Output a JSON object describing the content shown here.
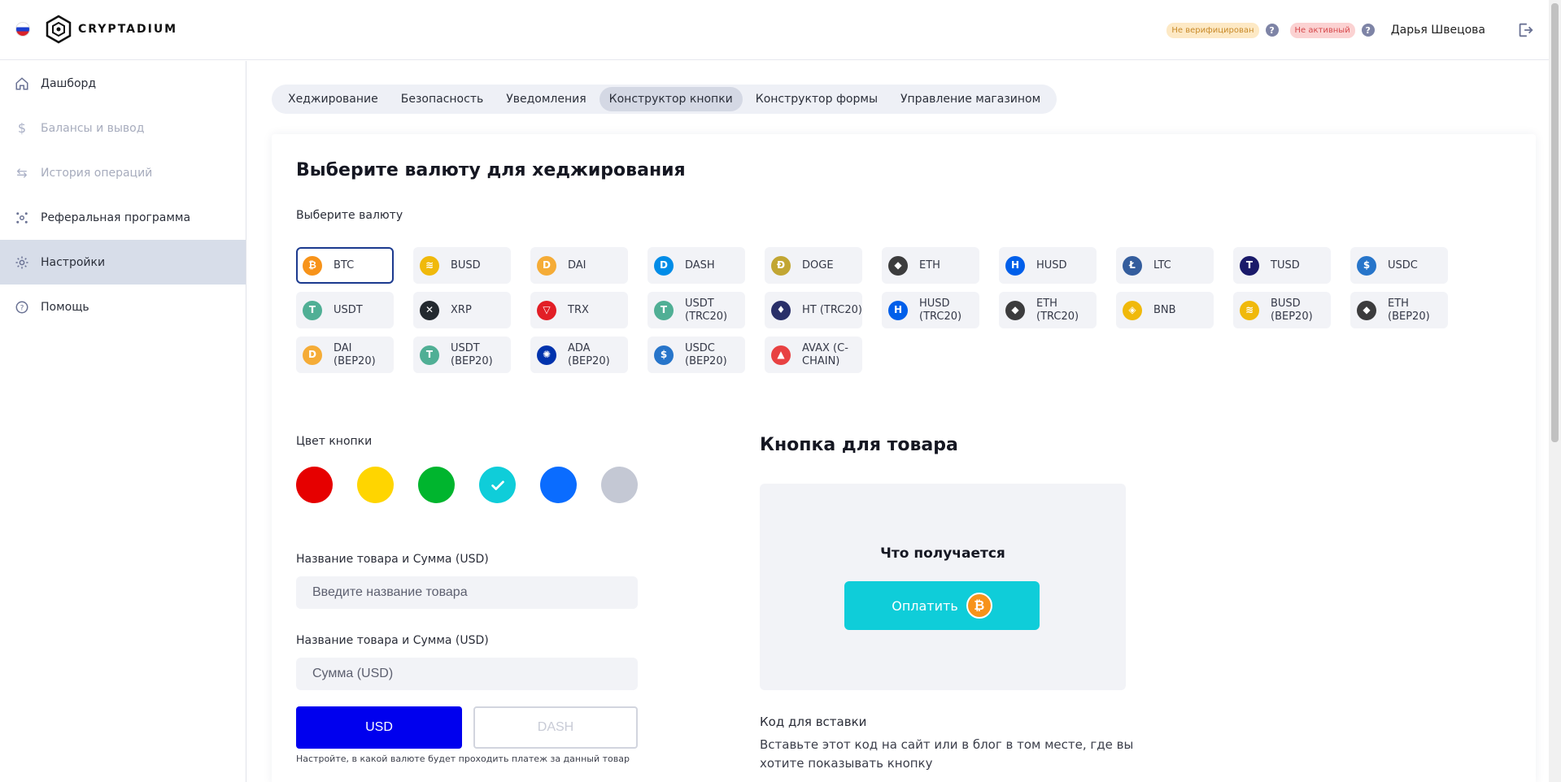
{
  "header": {
    "logo_text": "CRYPTADIUM",
    "badge_unverified": "Не верифицирован",
    "badge_inactive": "Не активный",
    "help_mark": "?",
    "user_name": "Дарья Швецова"
  },
  "sidebar": {
    "items": [
      {
        "label": "Дашборд",
        "icon": "home-icon",
        "state": "normal"
      },
      {
        "label": "Балансы и вывод",
        "icon": "dollar-icon",
        "state": "disabled"
      },
      {
        "label": "История операций",
        "icon": "arrows-icon",
        "state": "disabled"
      },
      {
        "label": "Реферальная программа",
        "icon": "network-icon",
        "state": "normal"
      },
      {
        "label": "Настройки",
        "icon": "gear-icon",
        "state": "active"
      },
      {
        "label": "Помощь",
        "icon": "help-icon",
        "state": "normal"
      }
    ]
  },
  "tabs": [
    {
      "label": "Хеджирование"
    },
    {
      "label": "Безопасность"
    },
    {
      "label": "Уведомления"
    },
    {
      "label": "Конструктор кнопки",
      "active": true
    },
    {
      "label": "Конструктор формы"
    },
    {
      "label": "Управление магазином"
    }
  ],
  "main": {
    "title": "Выберите валюту для хеджирования",
    "currency_label": "Выберите валюту",
    "currencies": [
      {
        "label": "BTC",
        "color": "#f7931a",
        "glyph": "₿",
        "selected": true
      },
      {
        "label": "BUSD",
        "color": "#f0b90b",
        "glyph": "≋"
      },
      {
        "label": "DAI",
        "color": "#f5ac37",
        "glyph": "D"
      },
      {
        "label": "DASH",
        "color": "#008ce7",
        "glyph": "D"
      },
      {
        "label": "DOGE",
        "color": "#c2a633",
        "glyph": "Ð"
      },
      {
        "label": "ETH",
        "color": "#3c3c3d",
        "glyph": "◆"
      },
      {
        "label": "HUSD",
        "color": "#005fea",
        "glyph": "H"
      },
      {
        "label": "LTC",
        "color": "#345d9d",
        "glyph": "Ł"
      },
      {
        "label": "TUSD",
        "color": "#1a1a6a",
        "glyph": "T"
      },
      {
        "label": "USDC",
        "color": "#2775ca",
        "glyph": "$"
      },
      {
        "label": "USDT",
        "color": "#50af95",
        "glyph": "T"
      },
      {
        "label": "XRP",
        "color": "#23292f",
        "glyph": "✕"
      },
      {
        "label": "TRX",
        "color": "#e21e26",
        "glyph": "▽"
      },
      {
        "label": "USDT (TRC20)",
        "color": "#50af95",
        "glyph": "T"
      },
      {
        "label": "HT (TRC20)",
        "color": "#2a3069",
        "glyph": "♦"
      },
      {
        "label": "HUSD (TRC20)",
        "color": "#005fea",
        "glyph": "H"
      },
      {
        "label": "ETH (TRC20)",
        "color": "#3c3c3d",
        "glyph": "◆"
      },
      {
        "label": "BNB",
        "color": "#f0b90b",
        "glyph": "◈"
      },
      {
        "label": "BUSD (BEP20)",
        "color": "#f0b90b",
        "glyph": "≋"
      },
      {
        "label": "ETH (BEP20)",
        "color": "#3c3c3d",
        "glyph": "◆"
      },
      {
        "label": "DAI (BEP20)",
        "color": "#f5ac37",
        "glyph": "D"
      },
      {
        "label": "USDT (BEP20)",
        "color": "#50af95",
        "glyph": "T"
      },
      {
        "label": "ADA (BEP20)",
        "color": "#0033ad",
        "glyph": "✺"
      },
      {
        "label": "USDC (BEP20)",
        "color": "#2775ca",
        "glyph": "$"
      },
      {
        "label": "AVAX (C-CHAIN)",
        "color": "#e84142",
        "glyph": "▲"
      }
    ],
    "color_label": "Цвет кнопки",
    "button_colors": [
      {
        "hex": "#e60000",
        "selected": false
      },
      {
        "hex": "#ffd500",
        "selected": false
      },
      {
        "hex": "#00b52e",
        "selected": false
      },
      {
        "hex": "#0fcdd9",
        "selected": true
      },
      {
        "hex": "#0a6cff",
        "selected": false
      },
      {
        "hex": "#c4c8d4",
        "selected": false
      }
    ],
    "name_label": "Название товара и Сумма (USD)",
    "name_placeholder": "Введите название товара",
    "amount_label": "Название товара и Сумма (USD)",
    "amount_placeholder": "Сумма (USD)",
    "btn_usd": "USD",
    "btn_dash": "DASH",
    "hint": "Настройте, в какой валюте будет проходить платеж за данный товар"
  },
  "preview": {
    "title": "Кнопка для товара",
    "caption": "Что получается",
    "pay_label": "Оплатить",
    "pay_coin": "₿",
    "code_label": "Код для вставки",
    "code_desc": "Вставьте этот код на сайт или в блог в том месте, где вы хотите показывать кнопку"
  }
}
